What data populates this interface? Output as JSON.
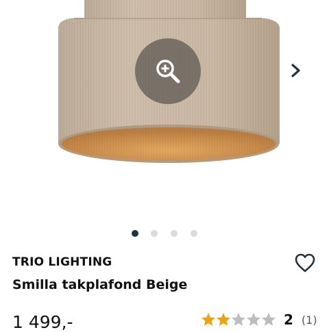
{
  "gallery": {
    "image_alt": "Smilla takplafond Beige",
    "zoom_icon": "zoom-in-icon",
    "next_icon": "chevron-right-icon",
    "slide_count": 4,
    "active_slide": 1
  },
  "product": {
    "brand": "TRIO LIGHTING",
    "name": "Smilla takplafond Beige",
    "price": "1 499,-",
    "favorite_icon": "heart-outline-icon"
  },
  "rating": {
    "stars": 2,
    "max_stars": 5,
    "score": "2",
    "count": "(1)"
  },
  "colors": {
    "star_filled": "#e8a317",
    "star_empty": "#bdbdbd",
    "dot_active": "#1f3340",
    "dot_inactive": "#d9dbe0"
  }
}
